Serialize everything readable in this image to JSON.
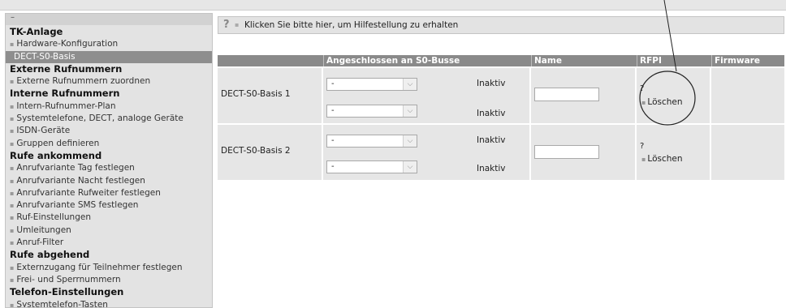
{
  "sidebar": {
    "collapse_label": "–",
    "sections": [
      {
        "title": "TK-Anlage",
        "items": [
          "Hardware-Konfiguration",
          "DECT-S0-Basis"
        ]
      },
      {
        "title": "Externe Rufnummern",
        "items": [
          "Externe Rufnummern zuordnen"
        ]
      },
      {
        "title": "Interne Rufnummern",
        "items": [
          "Intern-Rufnummer-Plan",
          "Systemtelefone, DECT, analoge Geräte",
          "ISDN-Geräte",
          "Gruppen definieren"
        ]
      },
      {
        "title": "Rufe ankommend",
        "items": [
          "Anrufvariante Tag festlegen",
          "Anrufvariante Nacht festlegen",
          "Anrufvariante Rufweiter festlegen",
          "Anrufvariante SMS festlegen",
          "Ruf-Einstellungen",
          "Umleitungen",
          "Anruf-Filter"
        ]
      },
      {
        "title": "Rufe abgehend",
        "items": [
          "Externzugang für Teilnehmer festlegen",
          "Frei- und Sperrnummern"
        ]
      },
      {
        "title": "Telefon-Einstellungen",
        "items": [
          "Systemtelefon-Tasten"
        ]
      }
    ],
    "active_item": "DECT-S0-Basis"
  },
  "help": {
    "icon": "?",
    "text": "Klicken Sie bitte hier, um Hilfestellung zu erhalten"
  },
  "table": {
    "headers": [
      "",
      "Angeschlossen an S0-Busse",
      "Name",
      "RFPI",
      "Firmware"
    ],
    "rows": [
      {
        "device": "DECT-S0-Basis 1",
        "bus1": "-",
        "status1": "Inaktiv",
        "bus2": "-",
        "status2": "Inaktiv",
        "name": "",
        "rfpi": "?",
        "delete": "Löschen",
        "firmware": ""
      },
      {
        "device": "DECT-S0-Basis 2",
        "bus1": "-",
        "status1": "Inaktiv",
        "bus2": "-",
        "status2": "Inaktiv",
        "name": "",
        "rfpi": "?",
        "delete": "Löschen",
        "firmware": ""
      }
    ]
  },
  "icons": {
    "help": "help-icon",
    "dropdown": "chevron-down-icon",
    "bullet": "bullet-icon"
  }
}
